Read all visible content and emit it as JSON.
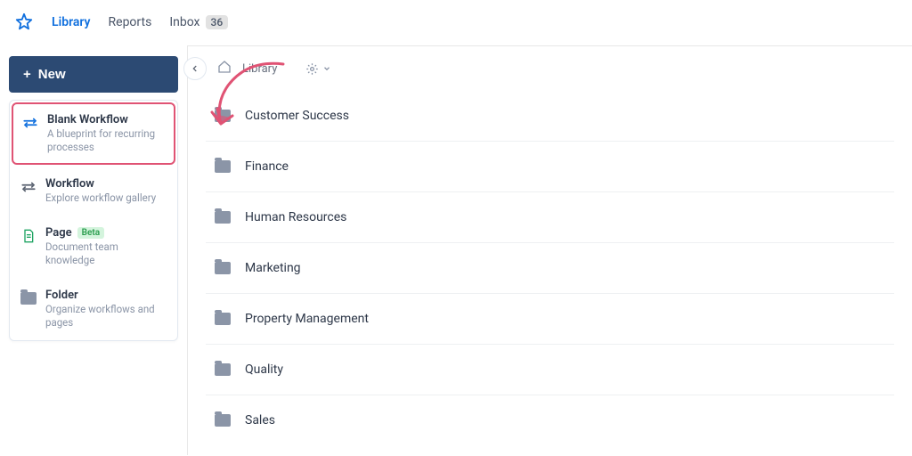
{
  "nav": {
    "library": "Library",
    "reports": "Reports",
    "inbox": "Inbox",
    "inbox_count": "36"
  },
  "sidebar": {
    "new_label": "New",
    "items": [
      {
        "title": "Blank Workflow",
        "desc": "A blueprint for recurring processes"
      },
      {
        "title": "Workflow",
        "desc": "Explore workflow gallery"
      },
      {
        "title": "Page",
        "desc": "Document team knowledge",
        "badge": "Beta"
      },
      {
        "title": "Folder",
        "desc": "Organize workflows and pages"
      }
    ]
  },
  "breadcrumb": {
    "library": "Library"
  },
  "folders": [
    "Customer Success",
    "Finance",
    "Human Resources",
    "Marketing",
    "Property Management",
    "Quality",
    "Sales"
  ],
  "colors": {
    "accent": "#0f6fde",
    "new_button": "#2c4a73",
    "highlight": "#e05374"
  }
}
